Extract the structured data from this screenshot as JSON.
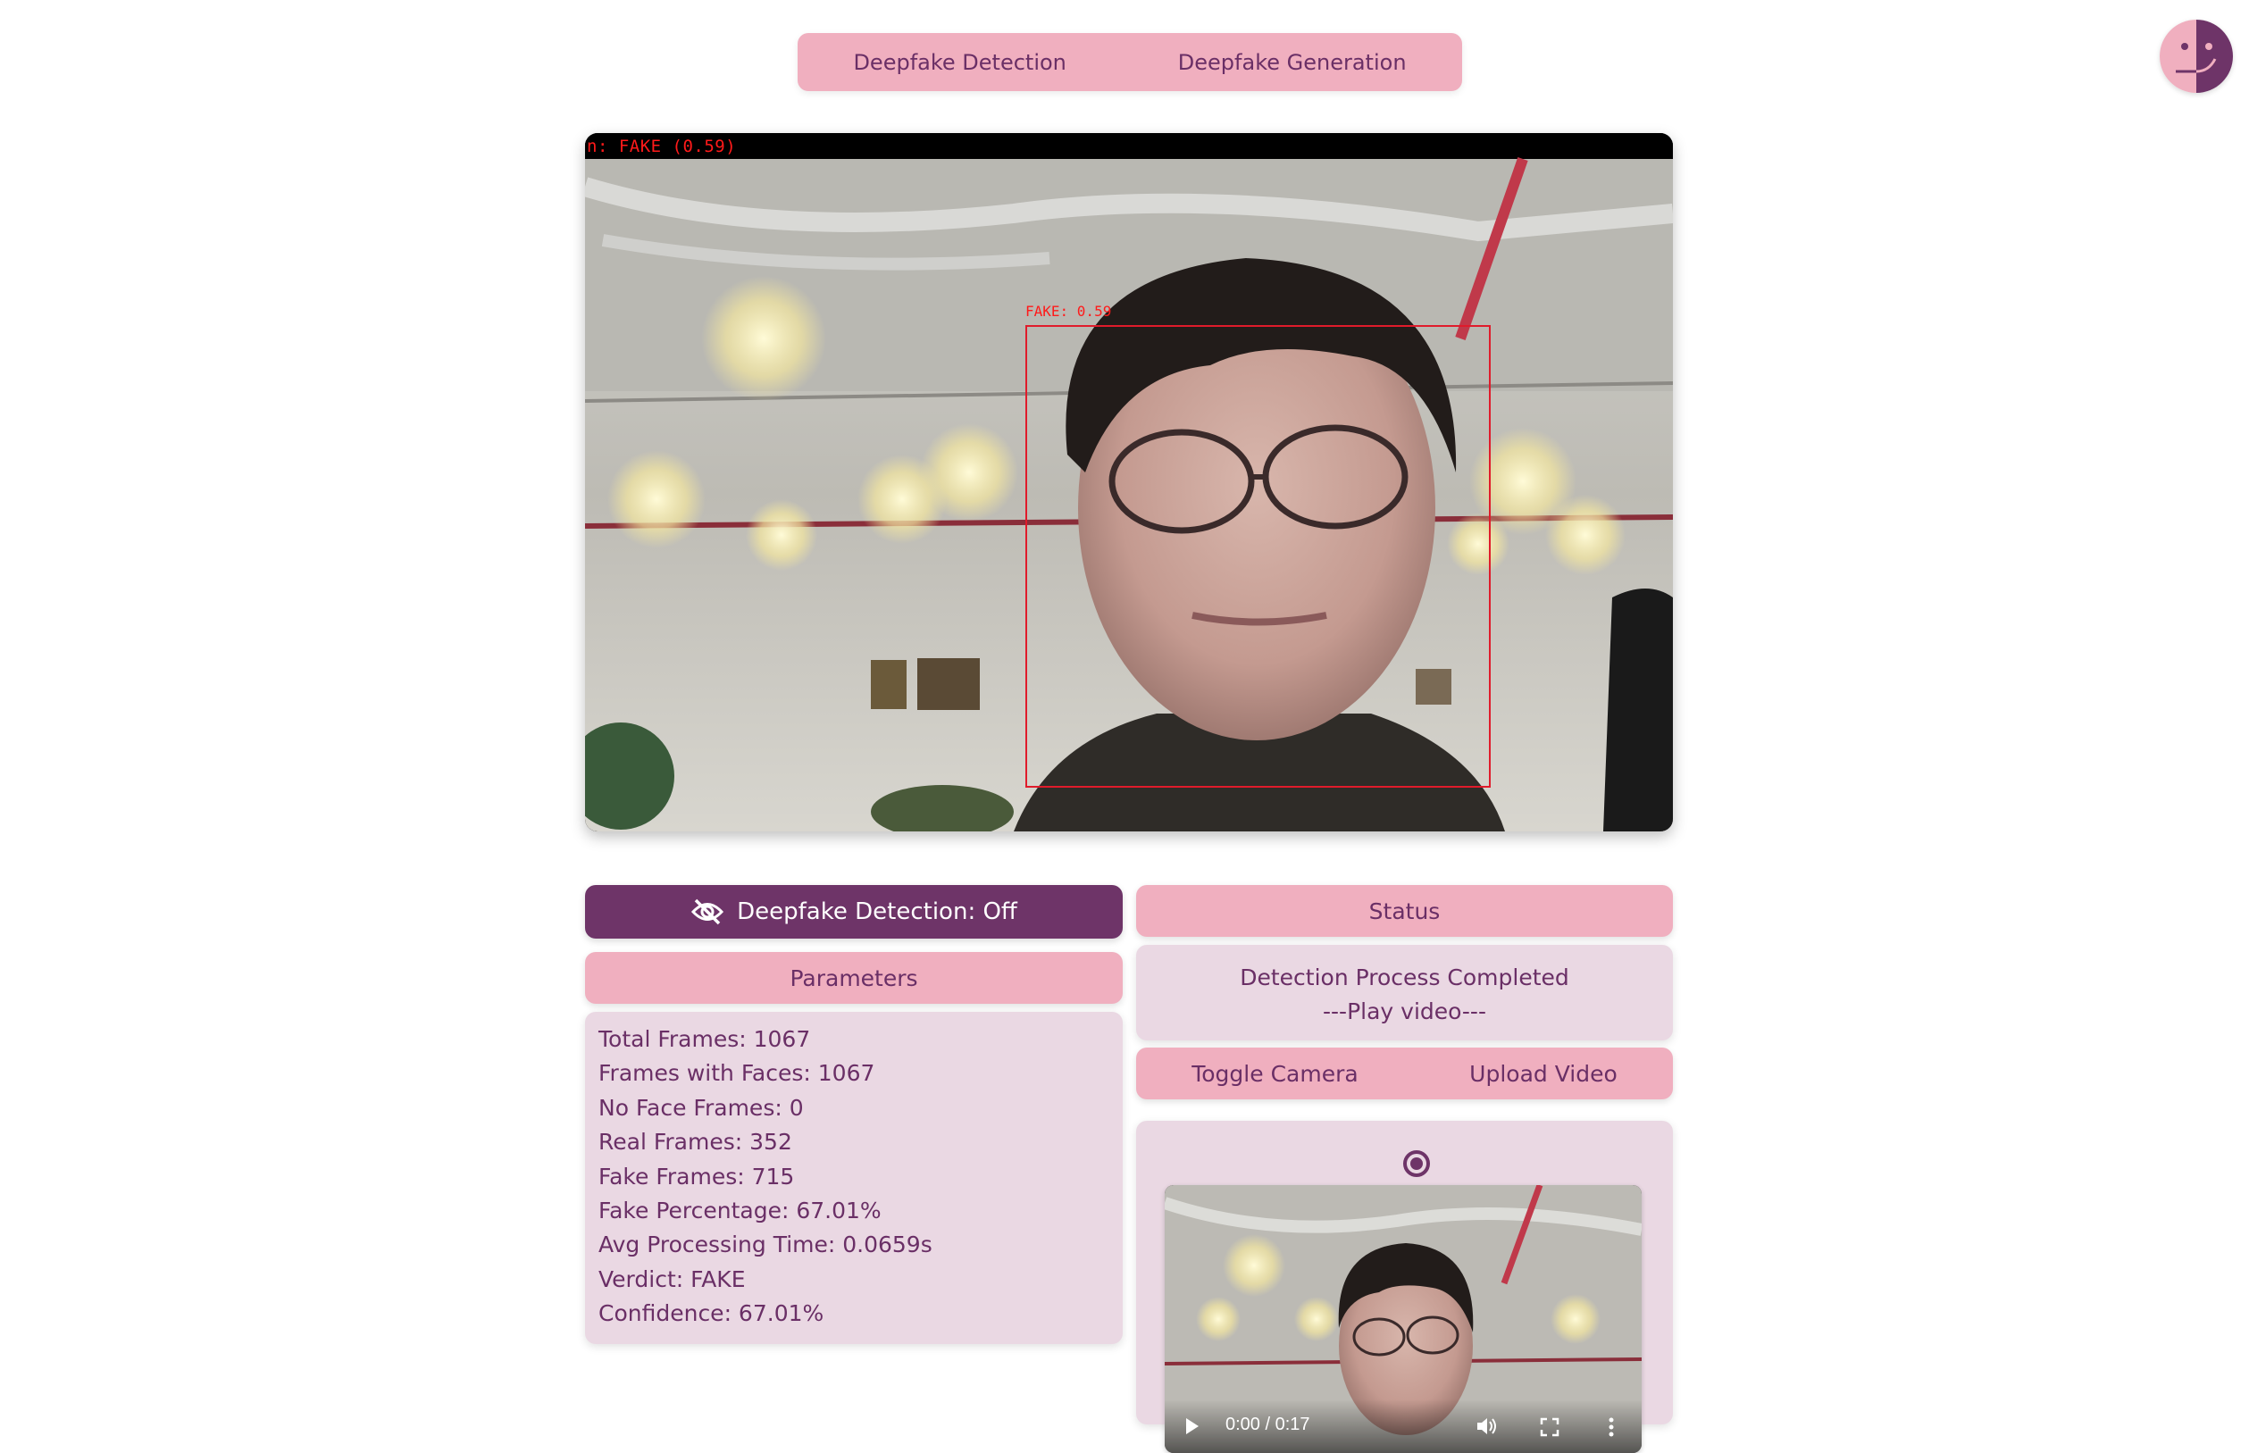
{
  "nav": {
    "tabs": [
      {
        "label": "Deepfake Detection"
      },
      {
        "label": "Deepfake Generation"
      }
    ]
  },
  "video": {
    "frame_label": "n: FAKE (0.59)",
    "face_label": "FAKE: 0.59"
  },
  "controls_panel": {
    "detection_toggle_label": "Deepfake Detection: Off",
    "parameters_title": "Parameters",
    "parameters": [
      "Total Frames: 1067",
      "Frames with Faces: 1067",
      "No Face Frames: 0",
      "Real Frames: 352",
      "Fake Frames: 715",
      "Fake Percentage: 67.01%",
      "Avg Processing Time: 0.0659s",
      "Verdict: FAKE",
      "Confidence: 67.01%"
    ]
  },
  "status_panel": {
    "title": "Status",
    "line1": "Detection Process Completed",
    "line2": "---Play video---",
    "toggle_camera": "Toggle Camera",
    "upload_video": "Upload Video"
  },
  "player": {
    "time": "0:00 / 0:17"
  },
  "colors": {
    "accent_dark": "#6e3468",
    "accent_pink": "#f0afbf",
    "panel_light": "#ead8e3",
    "detection_red": "#e01b2b"
  }
}
